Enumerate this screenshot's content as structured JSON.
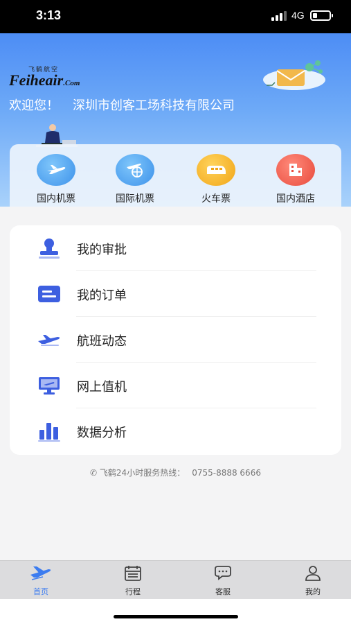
{
  "status_bar": {
    "time": "3:13",
    "network": "4G"
  },
  "header": {
    "logo_small": "飞鹤航空",
    "logo_brand": "Feiheair",
    "logo_com": ".Com",
    "welcome": "欢迎您！",
    "company": "深圳市创客工场科技有限公司"
  },
  "quick": [
    {
      "label": "国内机票",
      "icon": "plane-icon",
      "color": "#4aa6f0"
    },
    {
      "label": "国际机票",
      "icon": "globe-plane-icon",
      "color": "#4aa6f0"
    },
    {
      "label": "火车票",
      "icon": "train-icon",
      "color": "#f5b522"
    },
    {
      "label": "国内酒店",
      "icon": "hotel-icon",
      "color": "#ef5a4c"
    }
  ],
  "menu": [
    {
      "label": "我的审批",
      "icon": "stamp-icon"
    },
    {
      "label": "我的订单",
      "icon": "order-icon"
    },
    {
      "label": "航班动态",
      "icon": "flight-icon"
    },
    {
      "label": "网上值机",
      "icon": "checkin-monitor-icon"
    },
    {
      "label": "数据分析",
      "icon": "bar-chart-icon"
    }
  ],
  "hotline": {
    "label": "飞鹤24小时服务热线：",
    "number": "0755-8888 6666"
  },
  "tabs": [
    {
      "label": "首页",
      "icon": "home-bird-icon",
      "active": true
    },
    {
      "label": "行程",
      "icon": "calendar-icon",
      "active": false
    },
    {
      "label": "客服",
      "icon": "chat-icon",
      "active": false
    },
    {
      "label": "我的",
      "icon": "user-icon",
      "active": false
    }
  ],
  "colors": {
    "accent": "#3c7cf0",
    "menu_icon": "#3d5fe0"
  }
}
